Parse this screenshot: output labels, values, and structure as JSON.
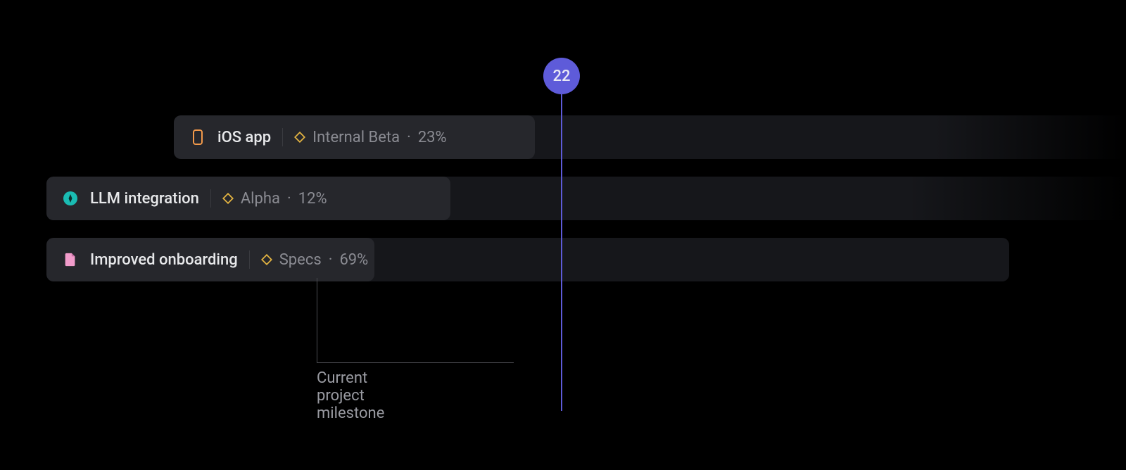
{
  "timeline": {
    "current_date": "22",
    "callout_label": "Current project milestone"
  },
  "projects": [
    {
      "title": "iOS app",
      "milestone": "Internal Beta",
      "percent": "23%",
      "icon": "phone-icon",
      "icon_color": "#F2994A"
    },
    {
      "title": "LLM integration",
      "milestone": "Alpha",
      "percent": "12%",
      "icon": "compass-icon",
      "icon_color": "#1ABCB3"
    },
    {
      "title": "Improved onboarding",
      "milestone": "Specs",
      "percent": "69%",
      "icon": "document-icon",
      "icon_color": "#F19CCB"
    }
  ],
  "colors": {
    "accent": "#5E5BD9",
    "diamond": "#E3B341"
  }
}
